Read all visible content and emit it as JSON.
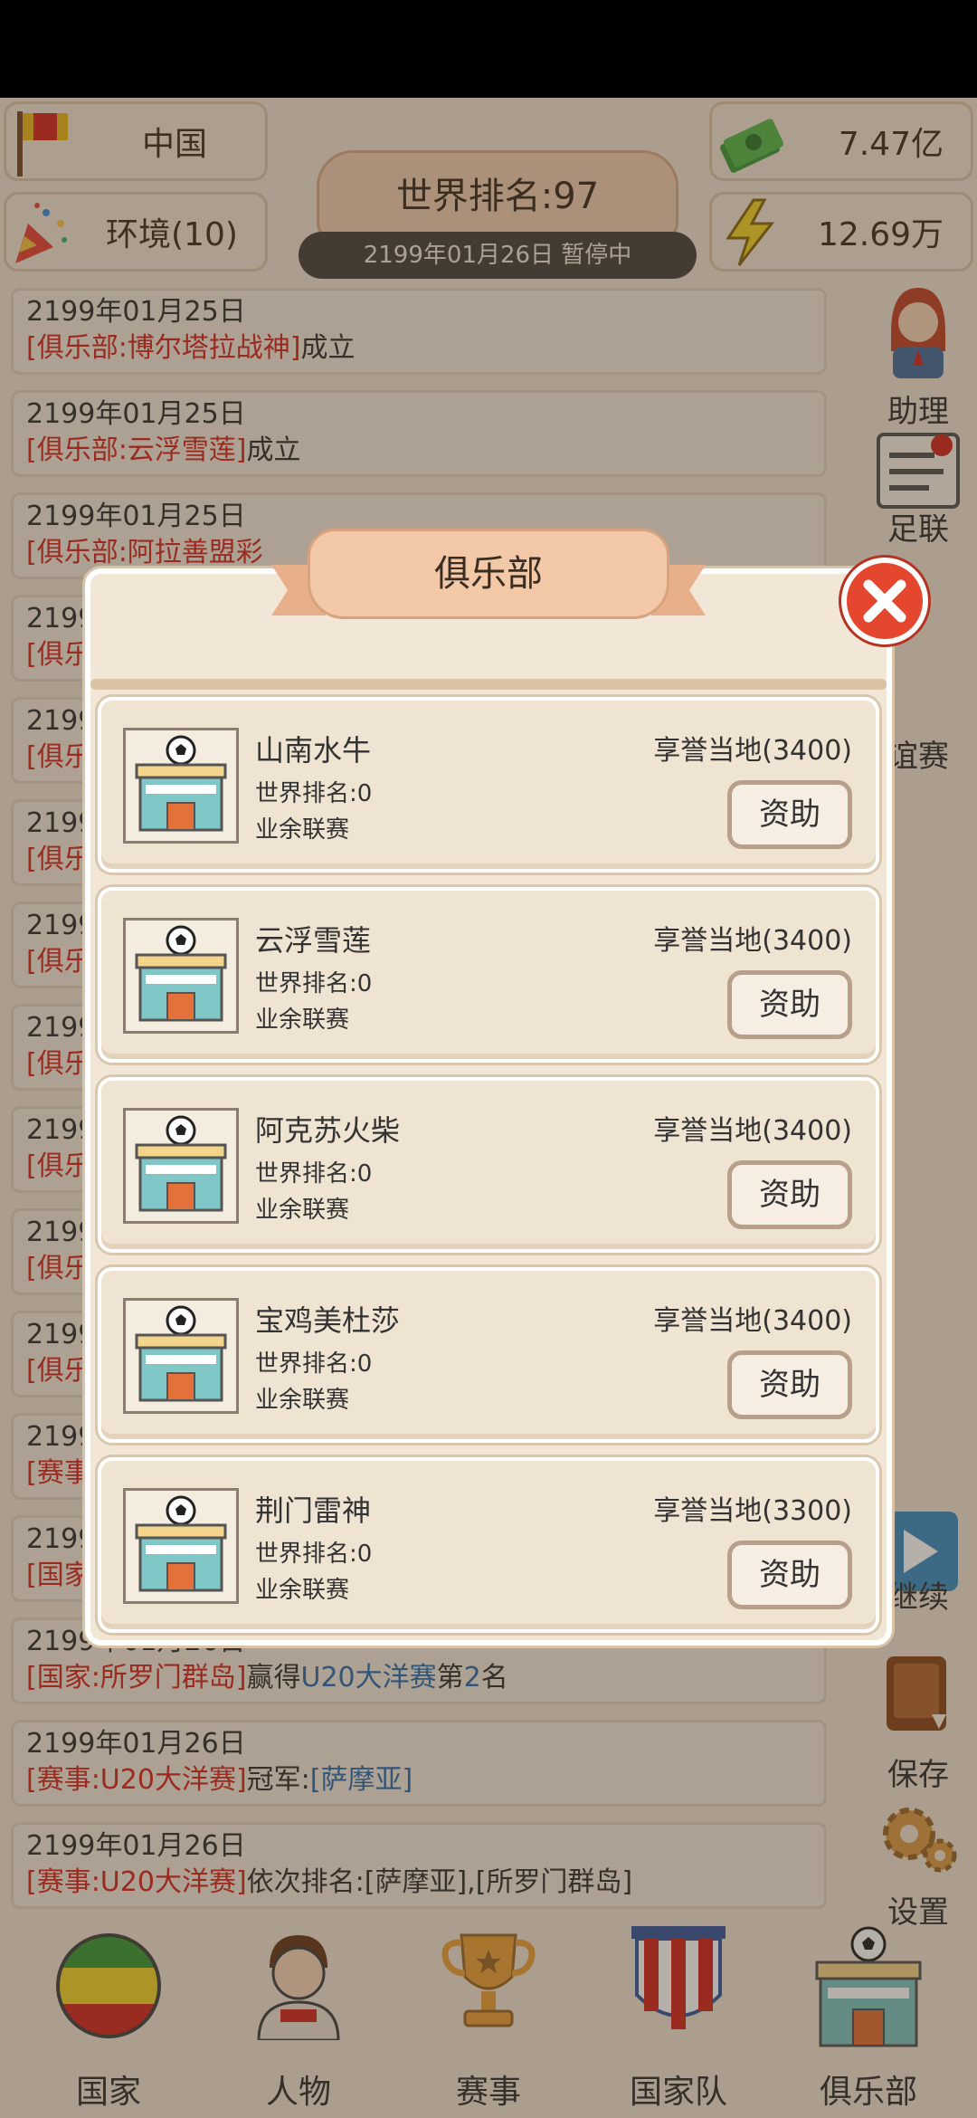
{
  "top": {
    "country": "中国",
    "environment": "环境(10)",
    "money": "7.47亿",
    "energy": "12.69万",
    "world_rank": "世界排名:97",
    "date_status": "2199年01月26日  暂停中"
  },
  "news": [
    {
      "date": "2199年01月25日",
      "parts": [
        {
          "t": "[俱乐部:博尔塔拉战神]",
          "c": "red"
        },
        {
          "t": "成立",
          "c": ""
        }
      ]
    },
    {
      "date": "2199年01月25日",
      "parts": [
        {
          "t": "[俱乐部:云浮雪莲]",
          "c": "red"
        },
        {
          "t": "成立",
          "c": ""
        }
      ]
    },
    {
      "date": "2199年01月25日",
      "parts": [
        {
          "t": "[俱乐部:阿拉善盟彩",
          "c": "red"
        }
      ]
    },
    {
      "date": "2199",
      "parts": [
        {
          "t": "[俱乐",
          "c": "red"
        }
      ]
    },
    {
      "date": "2199",
      "parts": [
        {
          "t": "[俱乐",
          "c": "red"
        }
      ]
    },
    {
      "date": "2199",
      "parts": [
        {
          "t": "[俱乐",
          "c": "red"
        }
      ]
    },
    {
      "date": "2199",
      "parts": [
        {
          "t": "[俱乐",
          "c": "red"
        }
      ]
    },
    {
      "date": "2199",
      "parts": [
        {
          "t": "[俱乐",
          "c": "red"
        }
      ]
    },
    {
      "date": "2199",
      "parts": [
        {
          "t": "[俱乐",
          "c": "red"
        }
      ]
    },
    {
      "date": "2199",
      "parts": [
        {
          "t": "[俱乐",
          "c": "red"
        }
      ]
    },
    {
      "date": "2199",
      "parts": [
        {
          "t": "[俱乐",
          "c": "red"
        }
      ]
    },
    {
      "date": "2199",
      "parts": [
        {
          "t": "[赛事",
          "c": "red"
        }
      ]
    },
    {
      "date": "2199",
      "parts": [
        {
          "t": "[国家",
          "c": "red"
        }
      ]
    },
    {
      "date": "2199年01月26日",
      "parts": [
        {
          "t": "[国家:所罗门群岛]",
          "c": "red"
        },
        {
          "t": "赢得",
          "c": ""
        },
        {
          "t": "U20大洋赛",
          "c": "blue"
        },
        {
          "t": "第",
          "c": ""
        },
        {
          "t": "2",
          "c": "blue"
        },
        {
          "t": "名",
          "c": ""
        }
      ]
    },
    {
      "date": "2199年01月26日",
      "parts": [
        {
          "t": "[赛事:U20大洋赛]",
          "c": "red"
        },
        {
          "t": "冠军:",
          "c": ""
        },
        {
          "t": "[萨摩亚]",
          "c": "blue"
        }
      ]
    },
    {
      "date": "2199年01月26日",
      "parts": [
        {
          "t": "[赛事:U20大洋赛]",
          "c": "red"
        },
        {
          "t": "依次排名:[萨摩亚],[所罗门群岛]",
          "c": ""
        }
      ]
    }
  ],
  "side_menu": {
    "assistant": "助理",
    "federation": "足联",
    "friendly": "谊赛",
    "continue": "继续",
    "save": "保存",
    "settings": "设置"
  },
  "bottom_nav": [
    "国家",
    "人物",
    "赛事",
    "国家队",
    "俱乐部"
  ],
  "modal": {
    "title": "俱乐部",
    "clubs": [
      {
        "name": "山南水牛",
        "rank": "世界排名:0",
        "league": "业余联赛",
        "rep": "享誉当地(3400)",
        "button": "资助"
      },
      {
        "name": "云浮雪莲",
        "rank": "世界排名:0",
        "league": "业余联赛",
        "rep": "享誉当地(3400)",
        "button": "资助"
      },
      {
        "name": "阿克苏火柴",
        "rank": "世界排名:0",
        "league": "业余联赛",
        "rep": "享誉当地(3400)",
        "button": "资助"
      },
      {
        "name": "宝鸡美杜莎",
        "rank": "世界排名:0",
        "league": "业余联赛",
        "rep": "享誉当地(3400)",
        "button": "资助"
      },
      {
        "name": "荆门雷神",
        "rank": "世界排名:0",
        "league": "业余联赛",
        "rep": "享誉当地(3300)",
        "button": "资助"
      }
    ]
  }
}
